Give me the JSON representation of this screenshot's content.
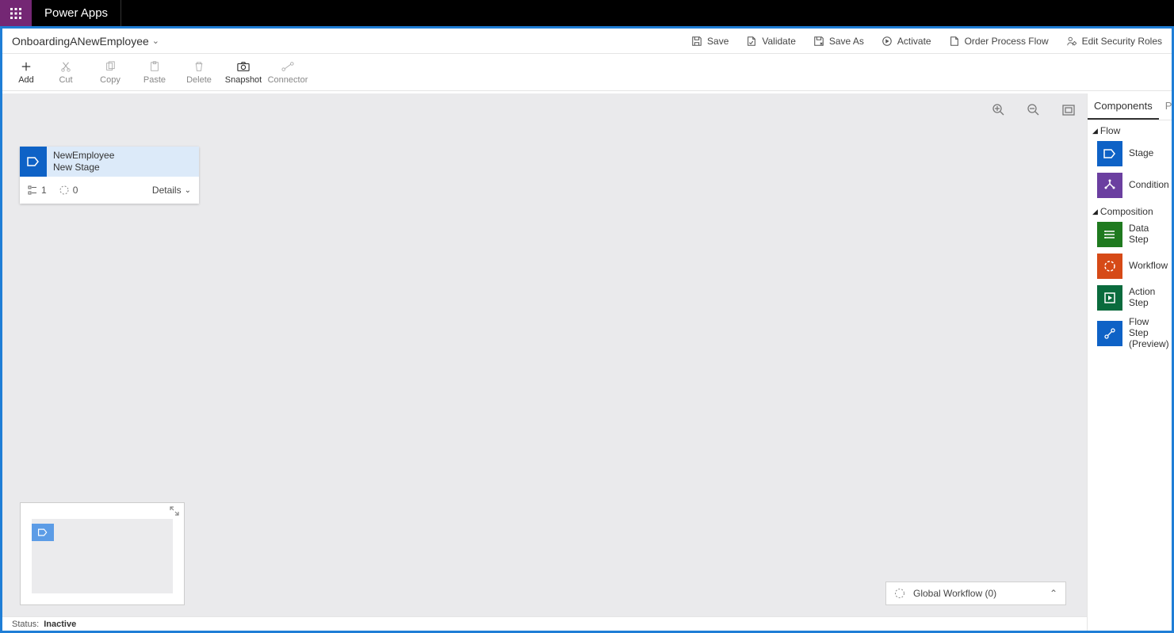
{
  "topbar": {
    "app_title": "Power Apps"
  },
  "header": {
    "process_name": "OnboardingANewEmployee",
    "actions": {
      "save": "Save",
      "validate": "Validate",
      "save_as": "Save As",
      "activate": "Activate",
      "order": "Order Process Flow",
      "security": "Edit Security Roles"
    }
  },
  "toolbar": {
    "add": "Add",
    "cut": "Cut",
    "copy": "Copy",
    "paste": "Paste",
    "delete": "Delete",
    "snapshot": "Snapshot",
    "connector": "Connector"
  },
  "stage": {
    "entity": "NewEmployee",
    "name": "New Stage",
    "step_count": "1",
    "wf_count": "0",
    "details": "Details"
  },
  "global_workflow": {
    "label": "Global Workflow (0)"
  },
  "status": {
    "label": "Status:",
    "value": "Inactive"
  },
  "panel": {
    "tabs": {
      "components": "Components",
      "properties": "Pro"
    },
    "sections": {
      "flow": "Flow",
      "composition": "Composition"
    },
    "components": {
      "stage": "Stage",
      "condition": "Condition",
      "data_step": "Data Step",
      "workflow": "Workflow",
      "action_step": "Action Step",
      "flow_step": "Flow Step (Preview)"
    }
  }
}
